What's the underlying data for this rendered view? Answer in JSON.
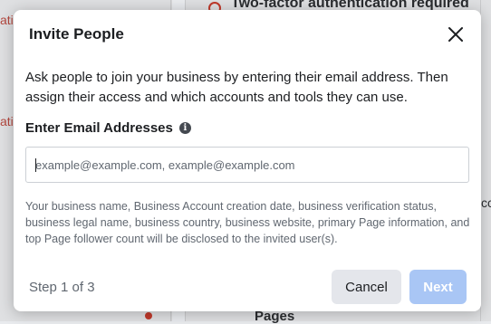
{
  "background": {
    "left_stubs": [
      "atio",
      "atio"
    ],
    "alert_text": "Two-factor authentication required",
    "right_cut_text": "cc",
    "pages_text": "Pages"
  },
  "modal": {
    "title": "Invite People",
    "close_icon": "close-icon",
    "description": "Ask people to join your business by entering their email address. Then assign their access and which accounts and tools they can use.",
    "email_label": "Enter Email Addresses",
    "info_icon": "i",
    "email_value": "",
    "email_placeholder": "example@example.com, example@example.com",
    "disclosure": "Your business name, Business Account creation date, business verification status, business legal name, business country, business website, primary Page information, and top Page follower count will be disclosed to the invited user(s).",
    "step": "Step 1 of 3",
    "cancel_label": "Cancel",
    "next_label": "Next"
  },
  "colors": {
    "next_button_disabled": "#a9c6f5",
    "cancel_button": "#e4e6eb",
    "alert_red": "#c0392b"
  }
}
